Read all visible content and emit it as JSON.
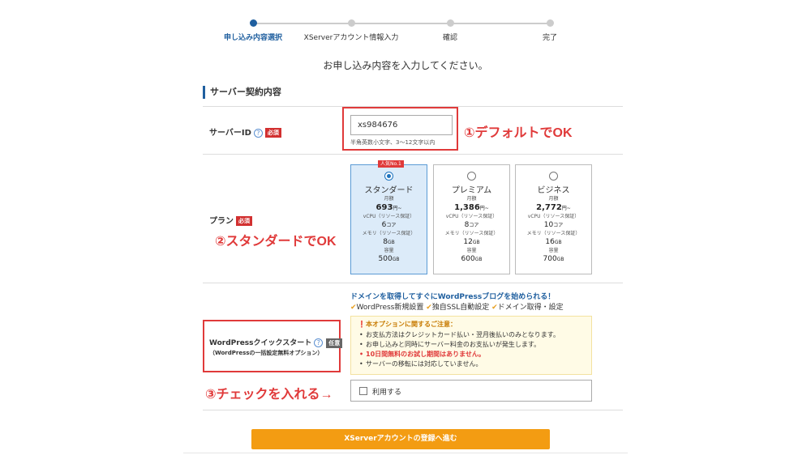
{
  "stepper": {
    "steps": [
      {
        "label": "申し込み内容選択",
        "active": true
      },
      {
        "label": "XServerアカウント情報入力",
        "active": false
      },
      {
        "label": "確認",
        "active": false
      },
      {
        "label": "完了",
        "active": false
      }
    ]
  },
  "instruction": "お申し込み内容を入力してください。",
  "section_title": "サーバー契約内容",
  "server_id": {
    "label": "サーバーID",
    "help": "?",
    "required": "必須",
    "value": "xs984676",
    "hint": "半角英数小文字、3〜12文字以内"
  },
  "plan": {
    "label": "プラン",
    "required": "必須",
    "popular_badge": "人気No.1",
    "price_caption": "月額",
    "vcpu_caption": "vCPU（リソース保証）",
    "memory_caption": "メモリ（リソース保証）",
    "storage_caption": "容量",
    "price_unit": "円~",
    "core_unit": "コア",
    "gb_unit": "GB",
    "options": [
      {
        "name": "スタンダード",
        "price": "693",
        "vcpu": "6",
        "memory": "8",
        "storage": "500",
        "selected": true
      },
      {
        "name": "プレミアム",
        "price": "1,386",
        "vcpu": "8",
        "memory": "12",
        "storage": "600",
        "selected": false
      },
      {
        "name": "ビジネス",
        "price": "2,772",
        "vcpu": "10",
        "memory": "16",
        "storage": "700",
        "selected": false
      }
    ]
  },
  "wordpress": {
    "label": "WordPressクイックスタート",
    "help": "?",
    "optional": "任意",
    "sublabel": "（WordPressの一括設定無料オプション）",
    "headline": "ドメインを取得してすぐにWordPressブログを始められる！",
    "features": [
      "WordPress新規設置",
      "独自SSL自動設定",
      "ドメイン取得・設定"
    ],
    "notice_title": "本オプションに関するご注意：",
    "notices": [
      {
        "text": "お支払方法はクレジットカード払い・翌月後払いのみとなります。",
        "warn": false
      },
      {
        "text": "お申し込みと同時にサーバー料金のお支払いが発生します。",
        "warn": false
      },
      {
        "text": "10日間無料のお試し期間はありません。",
        "warn": true
      },
      {
        "text": "サーバーの移転には対応していません。",
        "warn": false
      }
    ],
    "checkbox_label": "利用する",
    "checked": false
  },
  "annotations": {
    "server_id": "①デフォルトでOK",
    "plan": "②スタンダードでOK",
    "wordpress": "③チェックを入れる→"
  },
  "submit_label": "XServerアカウントの登録へ進む",
  "colors": {
    "accent": "#1f5f9f",
    "annotation_red": "#e03a3a",
    "submit_orange": "#f39c12",
    "selected_plan_bg": "#dcebf9"
  }
}
